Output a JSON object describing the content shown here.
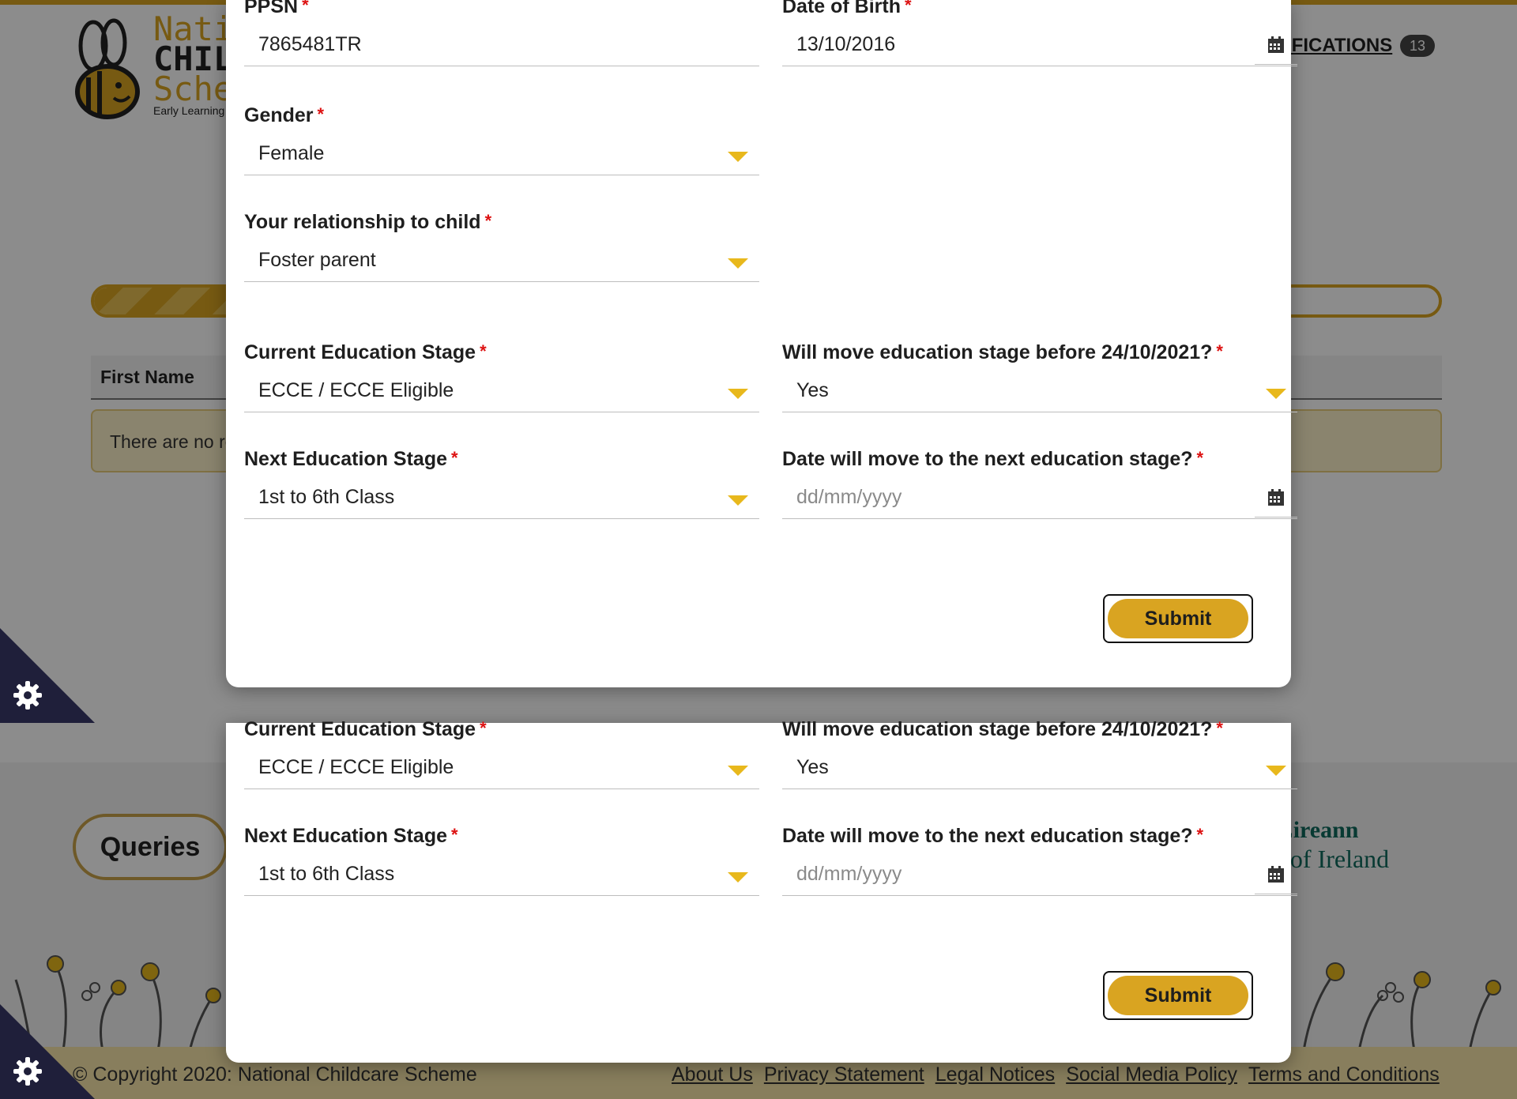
{
  "header": {
    "logo": {
      "line1": "Nation",
      "line2": "CHILDC",
      "line3": "Schem",
      "tagline": "Early Learning &"
    },
    "notifications_label": "IFICATIONS",
    "notifications_count": "13"
  },
  "progress": {
    "fill_fraction": 0.1
  },
  "table": {
    "first_column_header": "First Name",
    "empty_message": "There are no re"
  },
  "footer": {
    "queries_label": "Queries",
    "gov_line1": "hÉireann",
    "gov_line2": "nt of Ireland",
    "copyright": "© Copyright 2020: National Childcare Scheme",
    "links": [
      "About Us",
      "Privacy Statement",
      "Legal Notices",
      "Social Media Policy",
      "Terms and Conditions"
    ]
  },
  "colors": {
    "accent": "#d9a421",
    "required": "#dd1111",
    "caret": "#e8b81c",
    "cookie_bg": "#1f1f3a"
  },
  "icons": {
    "calendar": "calendar-icon",
    "cookie": "gear-icon",
    "dropdown": "chevron-down-icon"
  },
  "form": {
    "ppsn": {
      "label": "PPSN",
      "value": "7865481TR"
    },
    "dob": {
      "label": "Date of Birth",
      "value": "13/10/2016"
    },
    "gender": {
      "label": "Gender",
      "value": "Female"
    },
    "relationship": {
      "label": "Your relationship to child",
      "value": "Foster parent"
    },
    "current_stage": {
      "label": "Current Education Stage",
      "value": "ECCE / ECCE Eligible"
    },
    "will_move": {
      "label": "Will move education stage before 24/10/2021?",
      "value": "Yes"
    },
    "next_stage": {
      "label": "Next Education Stage",
      "value": "1st to 6th Class"
    },
    "move_date": {
      "label": "Date will move to the next education stage?",
      "placeholder": "dd/mm/yyyy"
    },
    "required_mark": "*",
    "submit_label": "Submit"
  }
}
